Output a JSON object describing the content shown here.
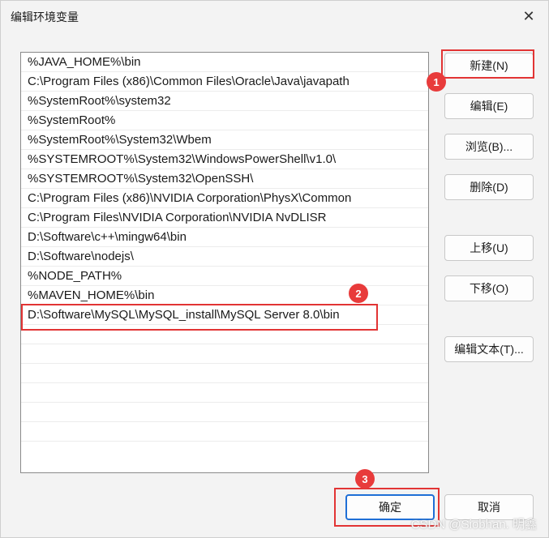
{
  "window": {
    "title": "编辑环境变量"
  },
  "list": {
    "items": [
      "%JAVA_HOME%\\bin",
      "C:\\Program Files (x86)\\Common Files\\Oracle\\Java\\javapath",
      "%SystemRoot%\\system32",
      "%SystemRoot%",
      "%SystemRoot%\\System32\\Wbem",
      "%SYSTEMROOT%\\System32\\WindowsPowerShell\\v1.0\\",
      "%SYSTEMROOT%\\System32\\OpenSSH\\",
      "C:\\Program Files (x86)\\NVIDIA Corporation\\PhysX\\Common",
      "C:\\Program Files\\NVIDIA Corporation\\NVIDIA NvDLISR",
      "D:\\Software\\c++\\mingw64\\bin",
      "D:\\Software\\nodejs\\",
      "%NODE_PATH%",
      "%MAVEN_HOME%\\bin",
      "D:\\Software\\MySQL\\MySQL_install\\MySQL Server 8.0\\bin"
    ]
  },
  "buttons": {
    "new": "新建(N)",
    "edit": "编辑(E)",
    "browse": "浏览(B)...",
    "delete": "删除(D)",
    "move_up": "上移(U)",
    "move_down": "下移(O)",
    "edit_text": "编辑文本(T)...",
    "ok": "确定",
    "cancel": "取消"
  },
  "markers": [
    "1",
    "2",
    "3"
  ],
  "watermark": "CSDN @Siobhan. 明鑫",
  "colors": {
    "highlight": "#e23434",
    "marker": "#e83b3b",
    "primary_border": "#1f6fd6"
  }
}
